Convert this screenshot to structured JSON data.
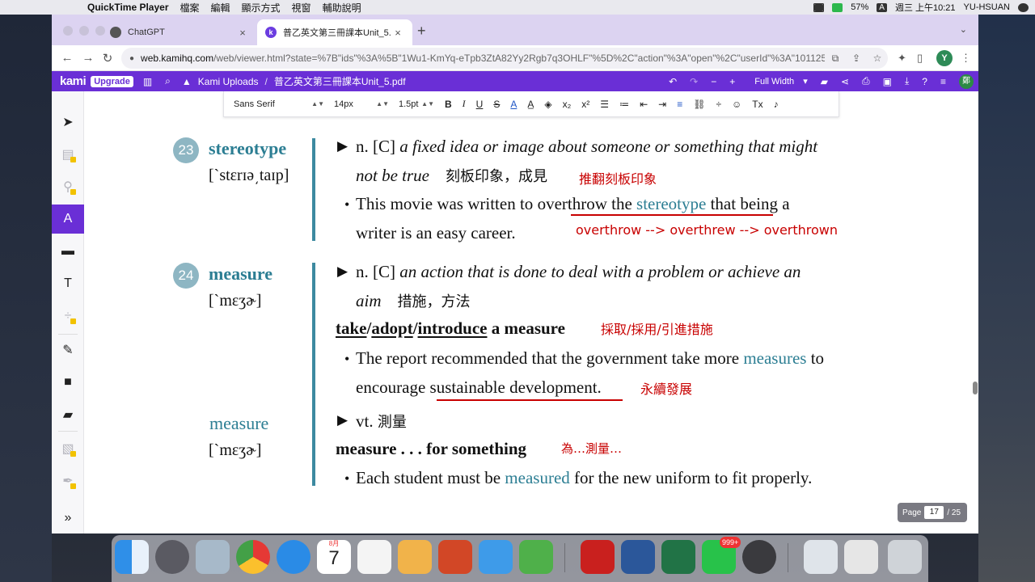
{
  "menubar": {
    "app_name": "QuickTime Player",
    "menus": [
      "檔案",
      "編輯",
      "顯示方式",
      "視窗",
      "輔助說明"
    ],
    "battery": "57%",
    "input_indicator": "A",
    "clock": "週三 上午10:21",
    "user": "YU-HSUAN"
  },
  "browser": {
    "tabs": [
      {
        "title": "ChatGPT",
        "active": false
      },
      {
        "title": "普乙英文第三冊課本Unit_5.pdf",
        "active": true
      }
    ],
    "url_host": "web.kamihq.com",
    "url_path": "/web/viewer.html?state=%7B\"ids\"%3A%5B\"1Wu1-KmYq-eTpb3ZtA82Yy2Rgb7q3OHLF\"%5D%2C\"action\"%3A\"open\"%2C\"userId\"%3A\"10112536...",
    "profile_initial": "Y"
  },
  "kami": {
    "logo": "kami",
    "upgrade": "Upgrade",
    "breadcrumb_root": "Kami Uploads",
    "breadcrumb_file": "普乙英文第三冊課本Unit_5.pdf",
    "zoom_mode": "Full Width",
    "account_initial": "鄭"
  },
  "format_toolbar": {
    "font": "Sans Serif",
    "size": "14px",
    "line_height": "1.5pt"
  },
  "entries": [
    {
      "number": "23",
      "word": "stereotype",
      "pronunciation": "[ˋstɛrɪə͵taɪp]",
      "pos": "n. [C]",
      "definition_1": "a fixed idea or image about someone or something that might",
      "definition_2": "not be true",
      "chinese": "刻板印象，成見",
      "note_1": "推翻刻板印象",
      "example_1a": "This movie was written to",
      "example_1b": "overthrow the",
      "example_1c": "stereotype",
      "example_1d": "that being a",
      "example_2": "writer is an easy career.",
      "note_2": "overthrow --> overthrew --> overthrown"
    },
    {
      "number": "24",
      "word": "measure",
      "pronunciation": "[ˋmɛʒɚ]",
      "pos": "n. [C]",
      "definition_1": "an action that is done to deal with a problem or achieve an",
      "definition_2": "aim",
      "chinese": "措施，方法",
      "collocation_a": "take",
      "collocation_b": "adopt",
      "collocation_c": "introduce",
      "collocation_d": "a measure",
      "note_1": "採取/採用/引進措施",
      "example_1a": "The report recommended that the government take more",
      "example_1b": "measures",
      "example_1c": "to",
      "example_2a": "encourage",
      "example_2b": "sustainable development.",
      "note_2": "永續發展"
    },
    {
      "word": "measure",
      "pronunciation": "[ˋmɛʒɚ]",
      "pos": "vt.",
      "chinese": "測量",
      "collocation": "measure . . . for something",
      "note_1": "為…測量…",
      "example_a": "Each student must be",
      "example_b": "measured",
      "example_c": "for the new uniform to fit properly."
    }
  ],
  "pager": {
    "label": "Page",
    "current": "17",
    "total": "/ 25"
  },
  "dock": {
    "calendar_month": "8月",
    "calendar_day": "7",
    "line_badge": "999+"
  },
  "colors": {
    "kami_purple": "#6a2fd6",
    "headword_teal": "#2c7e93",
    "annotation_red": "#c80000"
  }
}
